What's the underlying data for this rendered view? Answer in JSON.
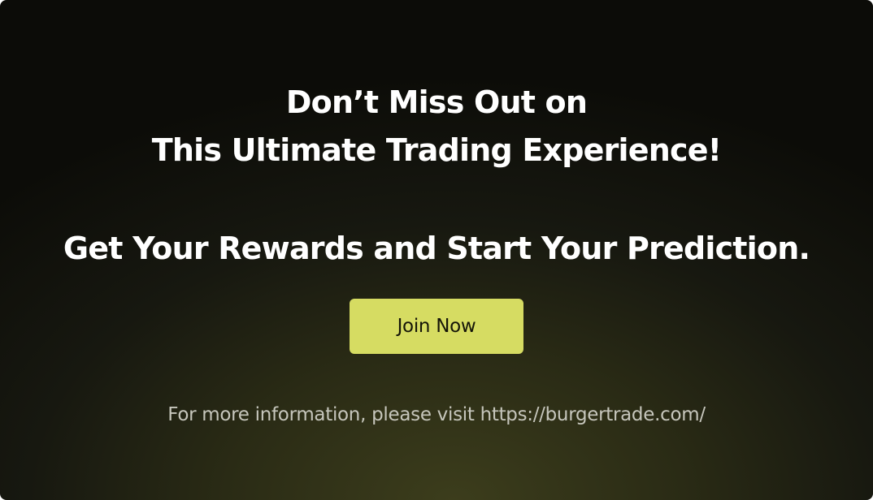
{
  "promo": {
    "headline_line1": "Don’t Miss Out on",
    "headline_line2": "This Ultimate Trading Experience!",
    "headline_line3": "Get Your Rewards and Start Your Prediction.",
    "cta_label": "Join Now",
    "info_text": "For more information, please visit https://burgertrade.com/"
  },
  "colors": {
    "background": "#171810",
    "cta_background": "#d6dc62",
    "heading_text": "#ffffff",
    "info_text": "#c6c6bc"
  }
}
